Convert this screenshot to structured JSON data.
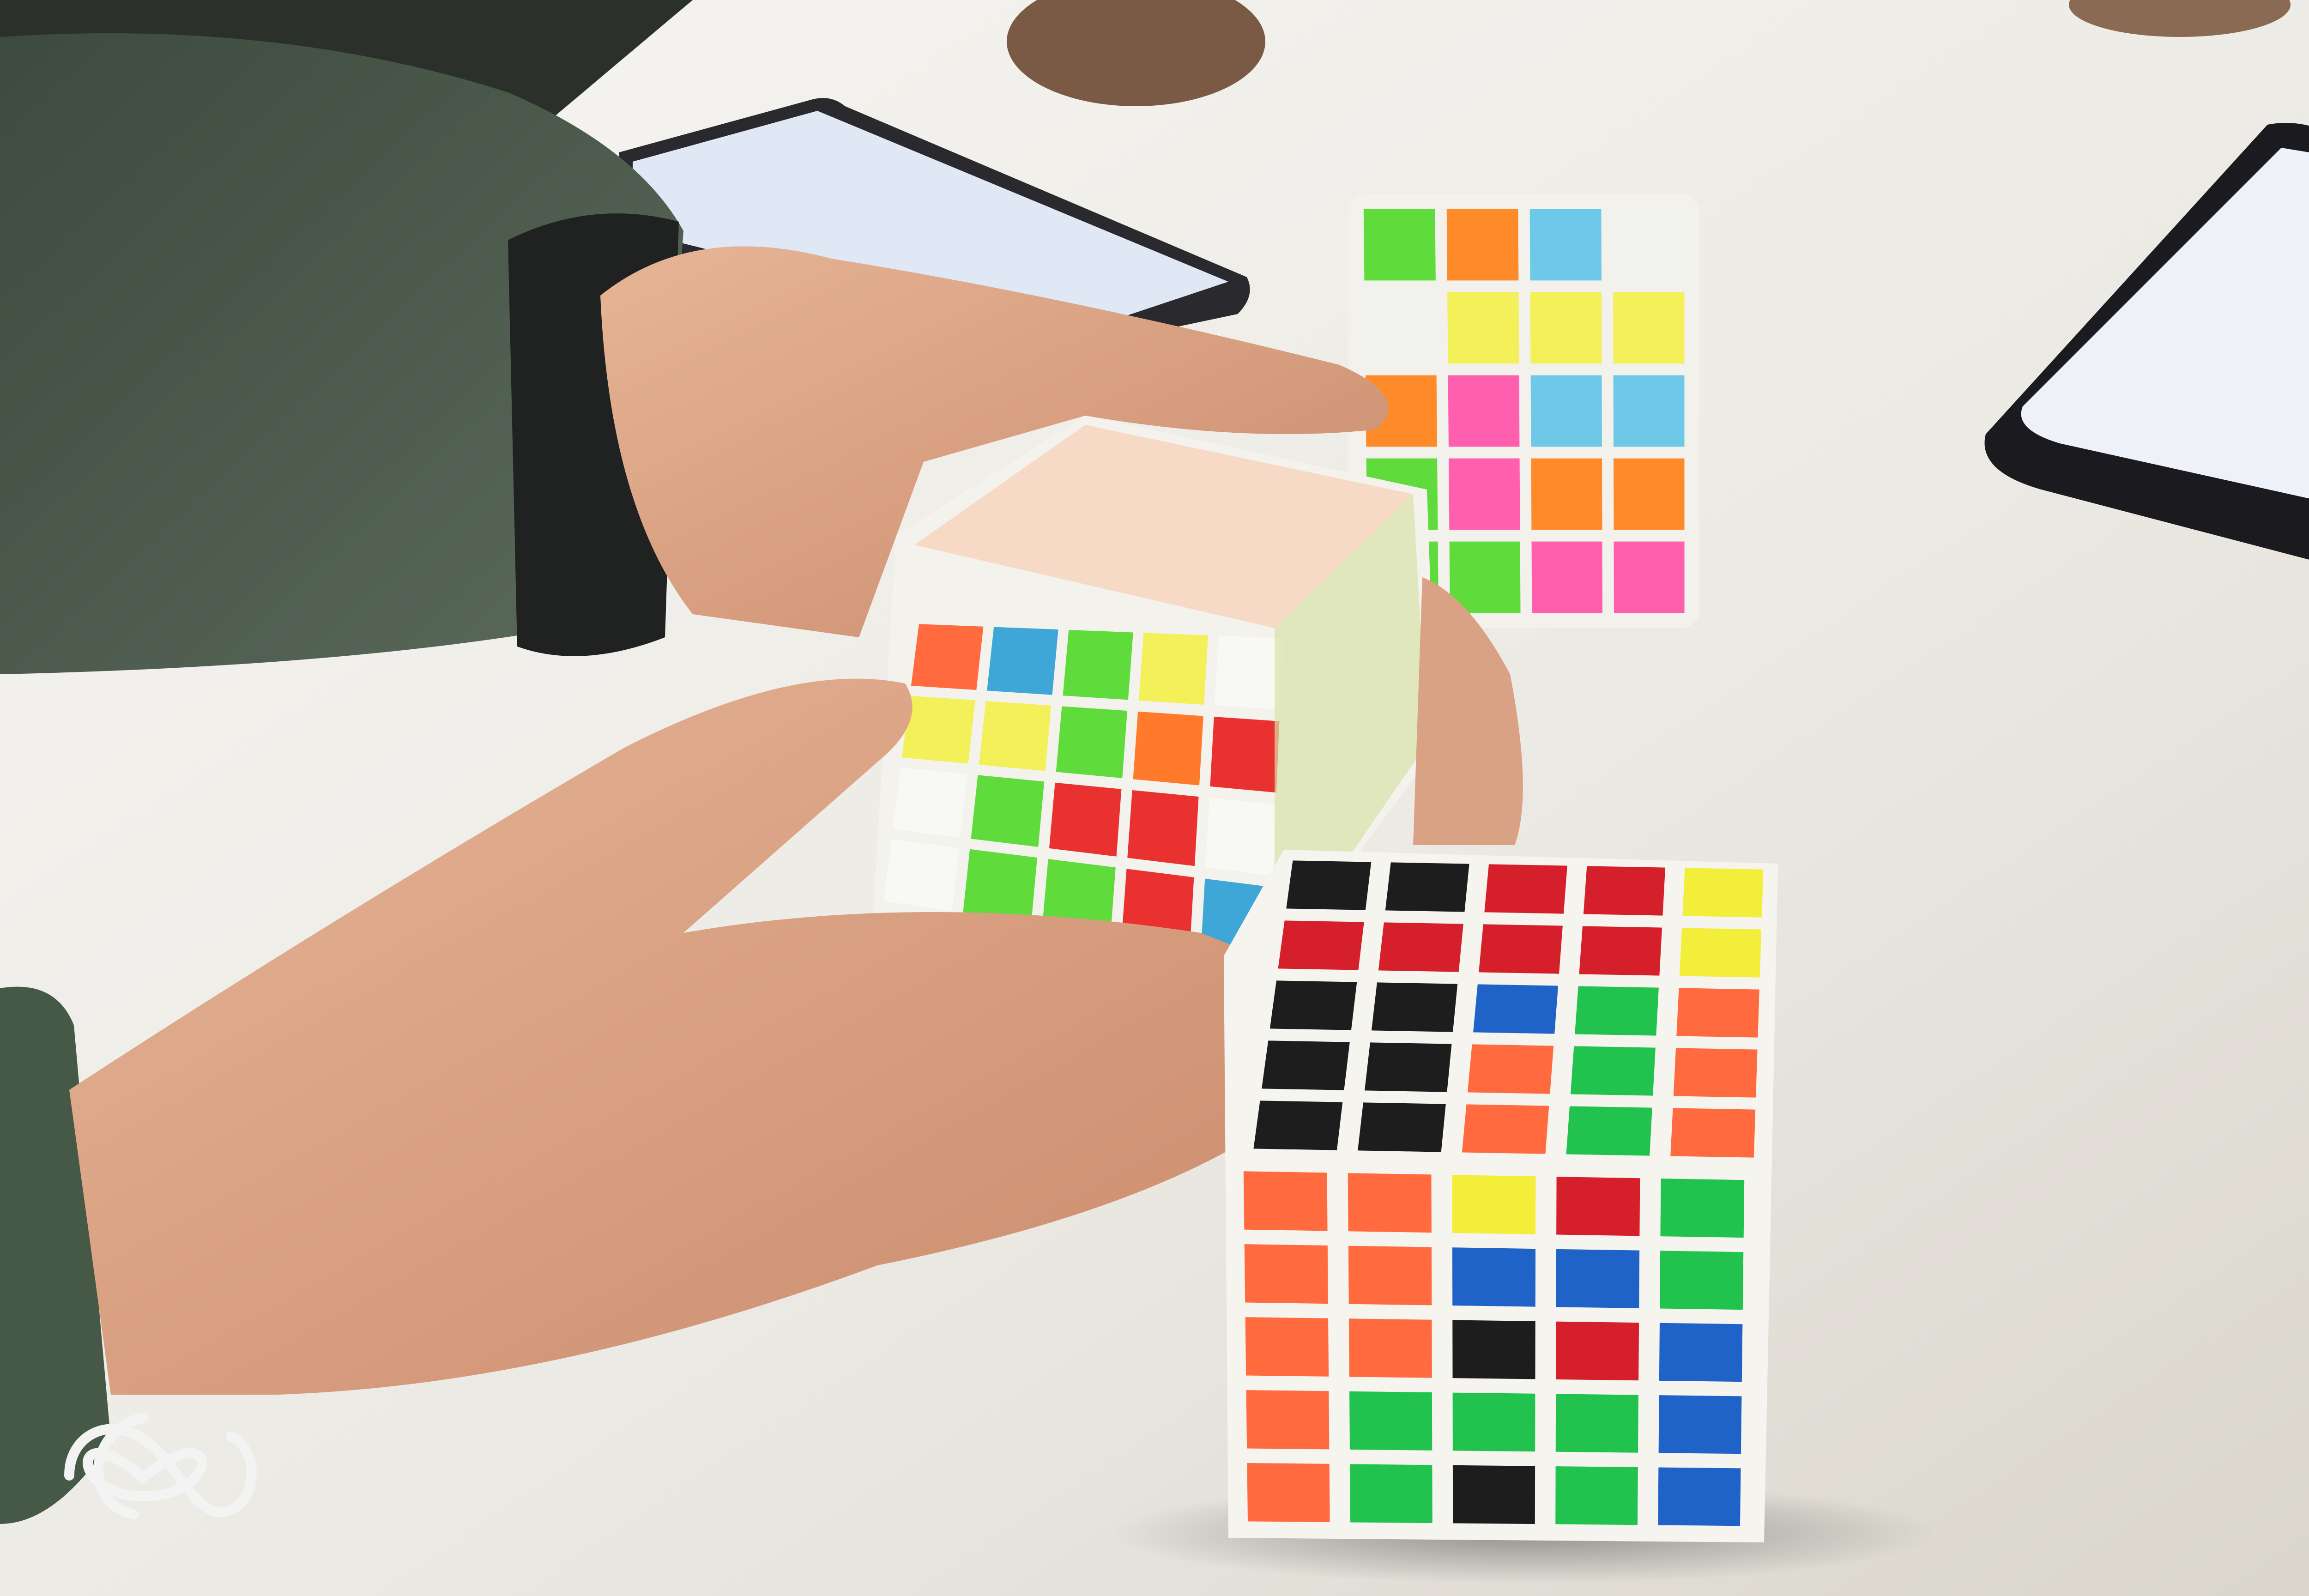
{
  "scene": {
    "description_type": "photo",
    "table_color": "#ecebe6",
    "sleeve_color": "#4d5d4e",
    "skin_color": "#d9a284",
    "phone_screen_color": "#e8eef6",
    "watermark": {
      "kind": "infinity-knot-logo",
      "color": "#f3f3f3"
    },
    "cubes": [
      {
        "id": "front-6x6",
        "top_face": [
          [
            "#1d1d1d",
            "#1d1d1d",
            "#d5202b",
            "#d5202b",
            "#f2ee3a"
          ],
          [
            "#d5202b",
            "#d5202b",
            "#d5202b",
            "#d5202b",
            "#f2ee3a"
          ],
          [
            "#1d1d1d",
            "#1d1d1d",
            "#1f63c8",
            "#21c34e",
            "#ff6a3f"
          ],
          [
            "#1d1d1d",
            "#1d1d1d",
            "#ff6a3f",
            "#21c34e",
            "#ff6a3f"
          ],
          [
            "#1d1d1d",
            "#1d1d1d",
            "#ff6a3f",
            "#21c34e",
            "#ff6a3f"
          ]
        ],
        "front_face": [
          [
            "#ff6a3f",
            "#ff6a3f",
            "#f2ee3a",
            "#d5202b",
            "#21c34e"
          ],
          [
            "#ff6a3f",
            "#ff6a3f",
            "#1f63c8",
            "#1f63c8",
            "#21c34e"
          ],
          [
            "#ff6a3f",
            "#ff6a3f",
            "#1d1d1d",
            "#d5202b",
            "#1f63c8"
          ],
          [
            "#ff6a3f",
            "#21c34e",
            "#21c34e",
            "#21c34e",
            "#1f63c8"
          ],
          [
            "#ff6a3f",
            "#21c34e",
            "#1d1d1d",
            "#21c34e",
            "#1f63c8"
          ]
        ]
      },
      {
        "id": "held-5x5",
        "front_face": [
          [
            "#ff6a3f",
            "#3fa6d8",
            "#5fdb3c",
            "#f3f05a",
            "#f8f8f4"
          ],
          [
            "#f3f05a",
            "#f3f05a",
            "#5fdb3c",
            "#ff7a2a",
            "#e9312f"
          ],
          [
            "#f8f8f4",
            "#5fdb3c",
            "#e9312f",
            "#e9312f",
            "#f8f8f4"
          ],
          [
            "#f8f8f4",
            "#5fdb3c",
            "#5fdb3c",
            "#e9312f",
            "#3fa6d8"
          ]
        ]
      },
      {
        "id": "back-4x4",
        "front_face": [
          [
            "#5fdb3c",
            "#ff8a2a",
            "#6ec9e8",
            "#f2f2ee"
          ],
          [
            "#f2f2ee",
            "#f3f05a",
            "#f3f05a",
            "#f3f05a"
          ],
          [
            "#ff8a2a",
            "#ff5fae",
            "#6ec9e8",
            "#6ec9e8"
          ],
          [
            "#5fdb3c",
            "#ff5fae",
            "#ff8a2a",
            "#ff8a2a"
          ],
          [
            "#5fdb3c",
            "#5fdb3c",
            "#ff5fae",
            "#ff5fae"
          ]
        ]
      }
    ]
  }
}
